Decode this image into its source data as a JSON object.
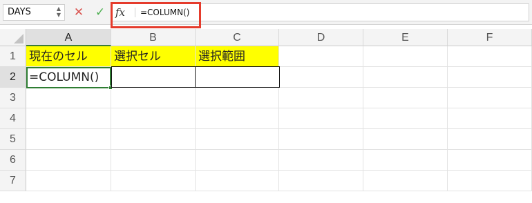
{
  "formula_bar": {
    "name_box": "DAYS",
    "fx": "fx",
    "formula": "=COLUMN()"
  },
  "columns": [
    "A",
    "B",
    "C",
    "D",
    "E",
    "F"
  ],
  "rows": [
    "1",
    "2",
    "3",
    "4",
    "5",
    "6",
    "7"
  ],
  "cells": {
    "A1": "現在のセル",
    "B1": "選択セル",
    "C1": "選択範囲",
    "A2": "=COLUMN()"
  },
  "colors": {
    "highlight_box": "#e53b2c",
    "header_fill": "#ffff00",
    "active_cell_border": "#2e7d32",
    "cancel_icon": "#d9534f",
    "confirm_icon": "#4caf50"
  },
  "active_cell": "A2"
}
